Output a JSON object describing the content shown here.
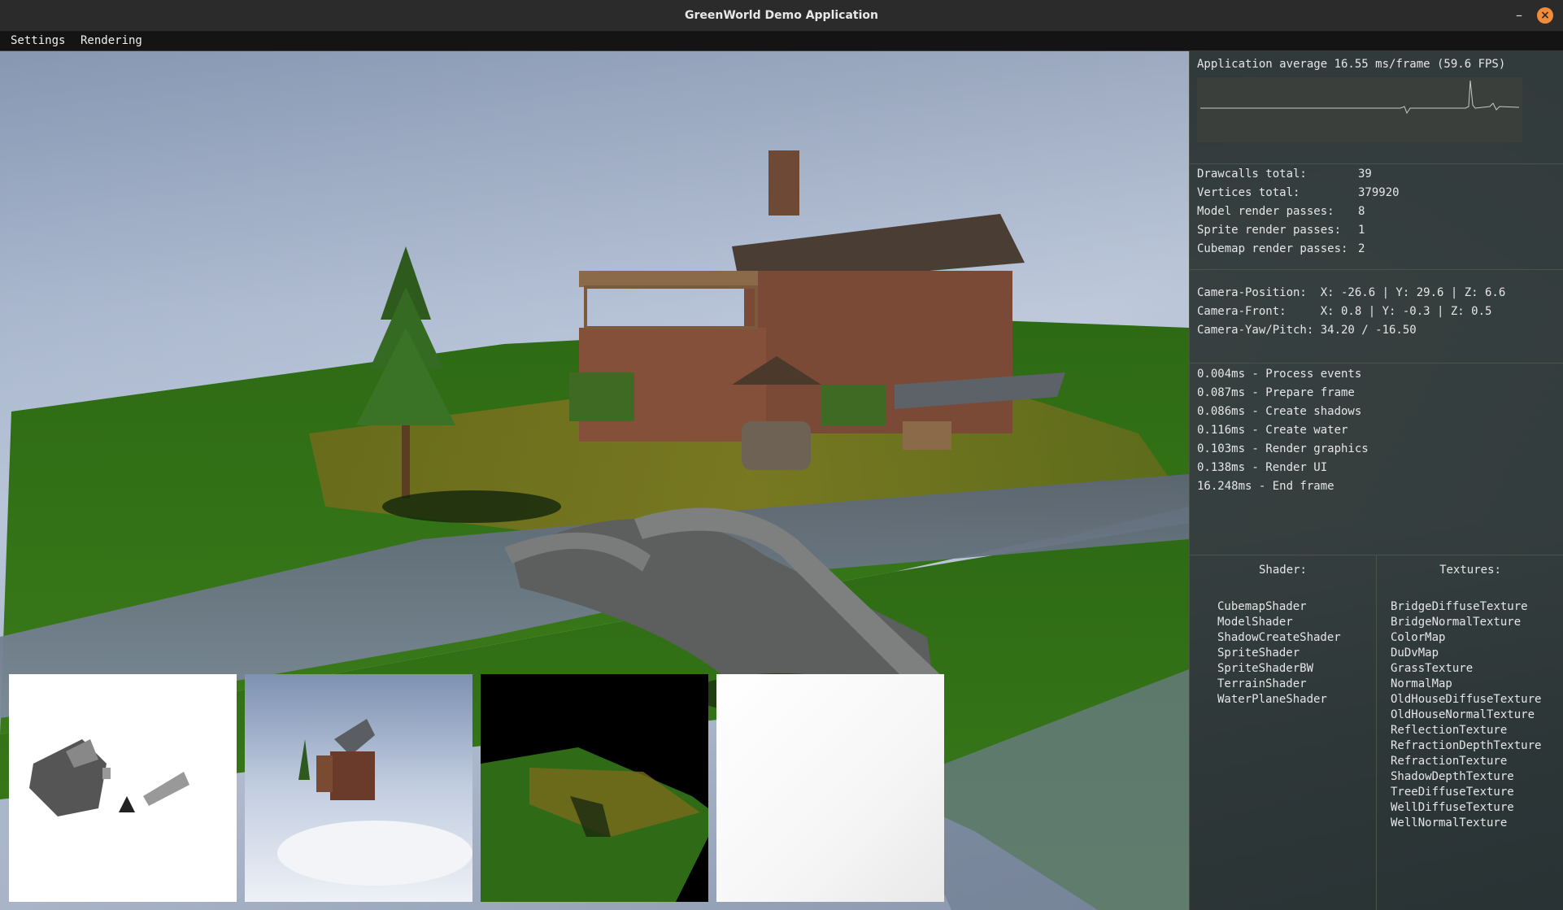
{
  "window": {
    "title": "GreenWorld Demo Application",
    "minimize_glyph": "–",
    "close_glyph": "×"
  },
  "menu": {
    "items": [
      "Settings",
      "Rendering"
    ]
  },
  "stats": {
    "fps_text": "Application average 16.55 ms/frame (59.6 FPS)",
    "counters": [
      {
        "label": "Drawcalls total:",
        "value": "39"
      },
      {
        "label": "Vertices total:",
        "value": "379920"
      },
      {
        "label": "Model render passes:",
        "value": "8"
      },
      {
        "label": "Sprite render passes:",
        "value": "1"
      },
      {
        "label": "Cubemap render passes:",
        "value": "2"
      }
    ],
    "camera": [
      "Camera-Position:  X: -26.6 | Y: 29.6 | Z: 6.6",
      "Camera-Front:     X: 0.8 | Y: -0.3 | Z: 0.5",
      "Camera-Yaw/Pitch: 34.20 / -16.50"
    ],
    "timings": [
      "0.004ms - Process events",
      "0.087ms - Prepare frame",
      "0.086ms - Create shadows",
      "0.116ms - Create water",
      "0.103ms - Render graphics",
      "0.138ms - Render UI",
      "16.248ms - End frame"
    ]
  },
  "shaders": {
    "header": "Shader:",
    "items": [
      "CubemapShader",
      "ModelShader",
      "ShadowCreateShader",
      "SpriteShader",
      "SpriteShaderBW",
      "TerrainShader",
      "WaterPlaneShader"
    ]
  },
  "textures": {
    "header": "Textures:",
    "items": [
      "BridgeDiffuseTexture",
      "BridgeNormalTexture",
      "ColorMap",
      "DuDvMap",
      "GrassTexture",
      "NormalMap",
      "OldHouseDiffuseTexture",
      "OldHouseNormalTexture",
      "ReflectionTexture",
      "RefractionDepthTexture",
      "RefractionTexture",
      "ShadowDepthTexture",
      "TreeDiffuseTexture",
      "WellDiffuseTexture",
      "WellNormalTexture"
    ]
  },
  "colors": {
    "accent_close": "#f28c38",
    "panel_bg": "#121a14",
    "grass": "#2f6b16",
    "water": "#7a8797"
  },
  "icons": {
    "minimize": "minimize-icon",
    "close": "close-icon"
  }
}
